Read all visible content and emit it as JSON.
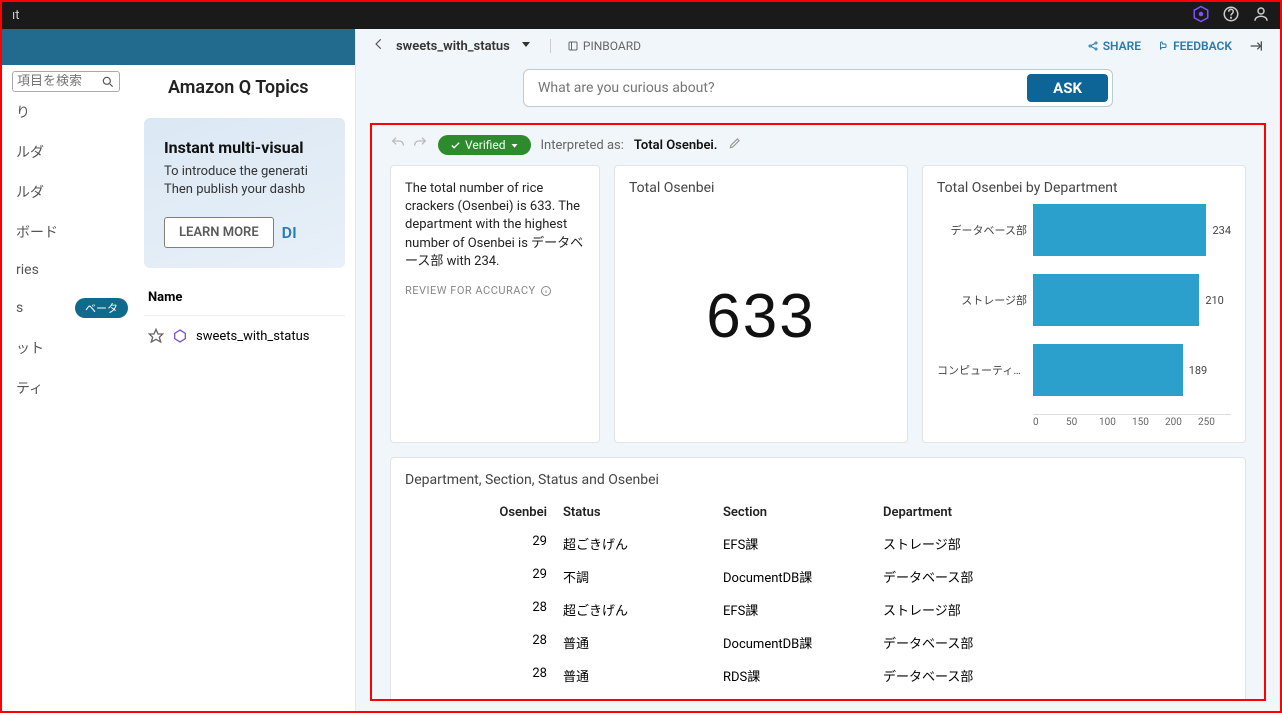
{
  "topbar": {
    "left_fragment": "ıt"
  },
  "sidebar": {
    "search_placeholder": "項目を検索",
    "title": "Amazon Q Topics",
    "promo": {
      "heading": "Instant multi-visual",
      "line1": "To introduce the generati",
      "line2": "Then publish your dashb",
      "learn_btn": "LEARN MORE",
      "dismiss_fragment": "DI"
    },
    "nav": [
      "り",
      "ルダ",
      "ルダ",
      "ボード",
      "ries",
      "s",
      "ット",
      "ティ"
    ],
    "nav_badge": "ベータ",
    "name_header": "Name",
    "topic_row": "sweets_with_status"
  },
  "header": {
    "topic_name": "sweets_with_status",
    "pinboard": "PINBOARD",
    "share": "SHARE",
    "feedback": "FEEDBACK"
  },
  "ask": {
    "placeholder": "What are you curious about?",
    "button": "ASK"
  },
  "interpret": {
    "verified": "Verified",
    "label": "Interpreted as:",
    "value": "Total Osenbei."
  },
  "story": {
    "text": "The total number of rice crackers (Osenbei) is 633. The department with the highest number of Osenbei is データベース部 with 234.",
    "review": "REVIEW FOR ACCURACY"
  },
  "total": {
    "title": "Total Osenbei",
    "value": "633"
  },
  "chart_data": {
    "type": "bar",
    "title": "Total Osenbei by Department",
    "categories": [
      "データベース部",
      "ストレージ部",
      "コンピューティン..."
    ],
    "values": [
      234,
      210,
      189
    ],
    "xlabel": "",
    "ylabel": "",
    "xlim": [
      0,
      250
    ],
    "ticks": [
      0,
      50,
      100,
      150,
      200,
      250
    ]
  },
  "table": {
    "title": "Department, Section, Status and Osenbei",
    "headers": {
      "osenbei": "Osenbei",
      "status": "Status",
      "section": "Section",
      "department": "Department"
    },
    "rows": [
      {
        "osenbei": "29",
        "status": "超ごきげん",
        "section": "EFS課",
        "department": "ストレージ部"
      },
      {
        "osenbei": "29",
        "status": "不調",
        "section": "DocumentDB課",
        "department": "データベース部"
      },
      {
        "osenbei": "28",
        "status": "超ごきげん",
        "section": "EFS課",
        "department": "ストレージ部"
      },
      {
        "osenbei": "28",
        "status": "普通",
        "section": "DocumentDB課",
        "department": "データベース部"
      },
      {
        "osenbei": "28",
        "status": "普通",
        "section": "RDS課",
        "department": "データベース部"
      }
    ]
  }
}
